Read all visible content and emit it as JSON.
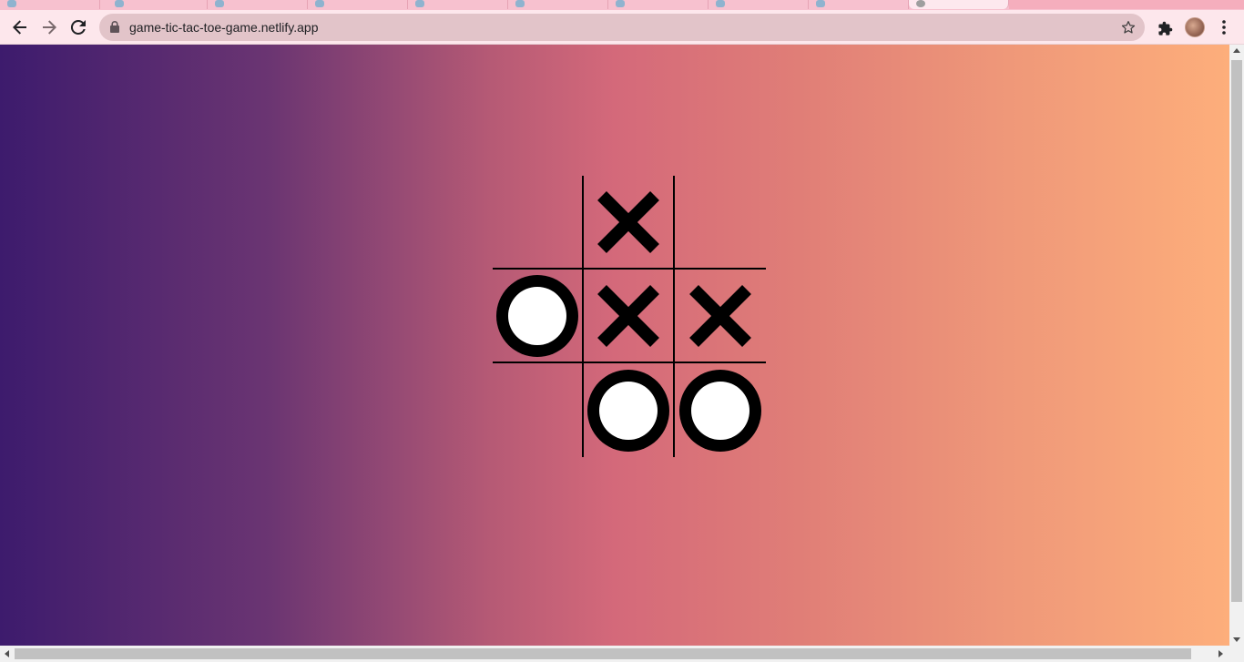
{
  "browser": {
    "url": "game-tic-tac-toe-game.netlify.app",
    "icons": {
      "back": "arrow-left-icon",
      "forward": "arrow-right-icon",
      "reload": "reload-icon",
      "lock": "lock-icon",
      "bookmark": "star-icon",
      "extensions": "puzzle-icon",
      "menu": "kebab-menu-icon"
    },
    "colors": {
      "tabstrip": "#f7c1cf",
      "toolbar": "#fde7ec",
      "omnibox": "#e2c4c9"
    }
  },
  "page": {
    "background_gradient": [
      "#3d1b6d",
      "#6b3572",
      "#b65a75",
      "#d4697a",
      "#e07e77",
      "#ef9879",
      "#fdae7b"
    ]
  },
  "game": {
    "board": [
      [
        "",
        "X",
        ""
      ],
      [
        "O",
        "X",
        "X"
      ],
      [
        "",
        "O",
        "O"
      ]
    ]
  }
}
